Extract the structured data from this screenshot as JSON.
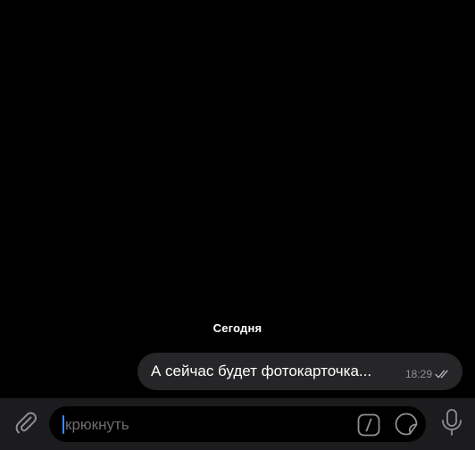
{
  "chat": {
    "date_header": "Сегодня",
    "messages": [
      {
        "text": "А сейчас будет фотокарточка...",
        "time": "18:29",
        "status": "read",
        "direction": "outgoing"
      }
    ]
  },
  "input_bar": {
    "input_value": "крюкнуть",
    "attach_icon": "paperclip-icon",
    "command_icon": "slash-command-icon",
    "sticker_icon": "sticker-icon",
    "mic_icon": "microphone-icon"
  },
  "colors": {
    "background": "#000000",
    "bubble": "#262628",
    "input_bar": "#1c1c1e",
    "accent": "#3a8ef6",
    "meta_text": "#8e8e93"
  }
}
